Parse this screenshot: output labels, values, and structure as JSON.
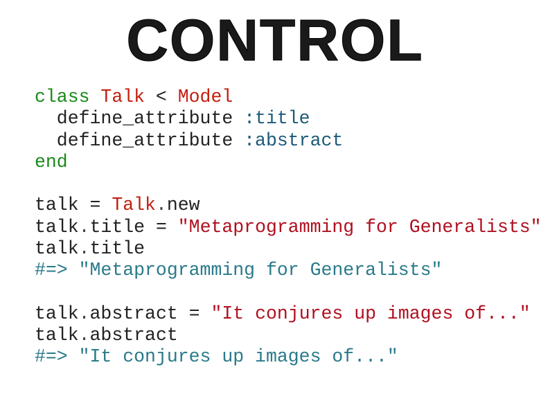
{
  "title": "Control",
  "code": {
    "l1_class": "class",
    "l1_talk": " Talk",
    "l1_lt": " < ",
    "l1_model": "Model",
    "l2_indent": "  define_attribute ",
    "l2_sym": ":title",
    "l3_indent": "  define_attribute ",
    "l3_sym": ":abstract",
    "l4_end": "end",
    "l6_a": "talk ",
    "l6_eq": "=",
    "l6_b": " Talk",
    "l6_c": ".",
    "l6_d": "new",
    "l7_a": "talk",
    "l7_b": ".",
    "l7_c": "title",
    "l7_d": " = ",
    "l7_e": "\"Metaprogramming for Generalists\"",
    "l8_a": "talk",
    "l8_b": ".",
    "l8_c": "title",
    "l9": "#=> \"Metaprogramming for Generalists\"",
    "l11_a": "talk",
    "l11_b": ".",
    "l11_c": "abstract",
    "l11_d": " = ",
    "l11_e": "\"It conjures up images of...\"",
    "l12_a": "talk",
    "l12_b": ".",
    "l12_c": "abstract",
    "l13": "#=> \"It conjures up images of...\""
  }
}
